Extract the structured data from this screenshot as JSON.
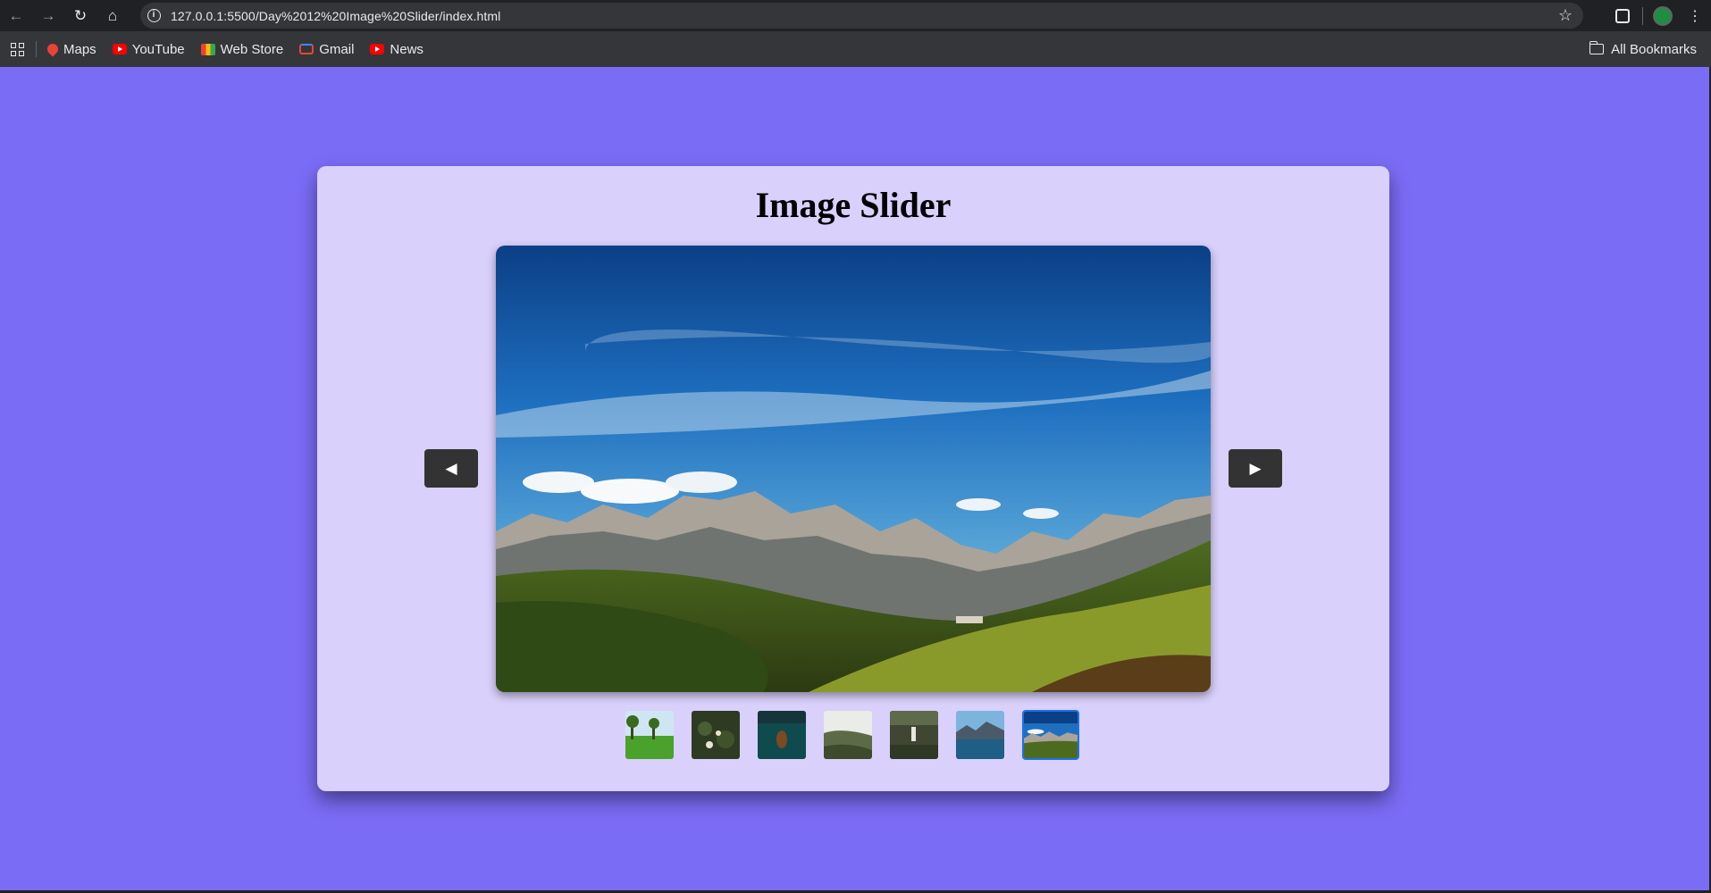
{
  "browser": {
    "url": "127.0.0.1:5500/Day%2012%20Image%20Slider/index.html",
    "bookmarks": [
      {
        "label": "Maps",
        "icon": "maps-icon"
      },
      {
        "label": "YouTube",
        "icon": "youtube-icon"
      },
      {
        "label": "Web Store",
        "icon": "web-store-icon"
      },
      {
        "label": "Gmail",
        "icon": "gmail-icon"
      },
      {
        "label": "News",
        "icon": "youtube-icon"
      }
    ],
    "all_bookmarks_label": "All Bookmarks"
  },
  "page": {
    "background": "#7b6cf6",
    "card_background": "#d9d0fb",
    "title": "Image Slider",
    "prev_label": "◀",
    "next_label": "▶",
    "thumbnail_count": 7,
    "active_thumbnail": 7,
    "active_border_color": "#1a73e8"
  }
}
